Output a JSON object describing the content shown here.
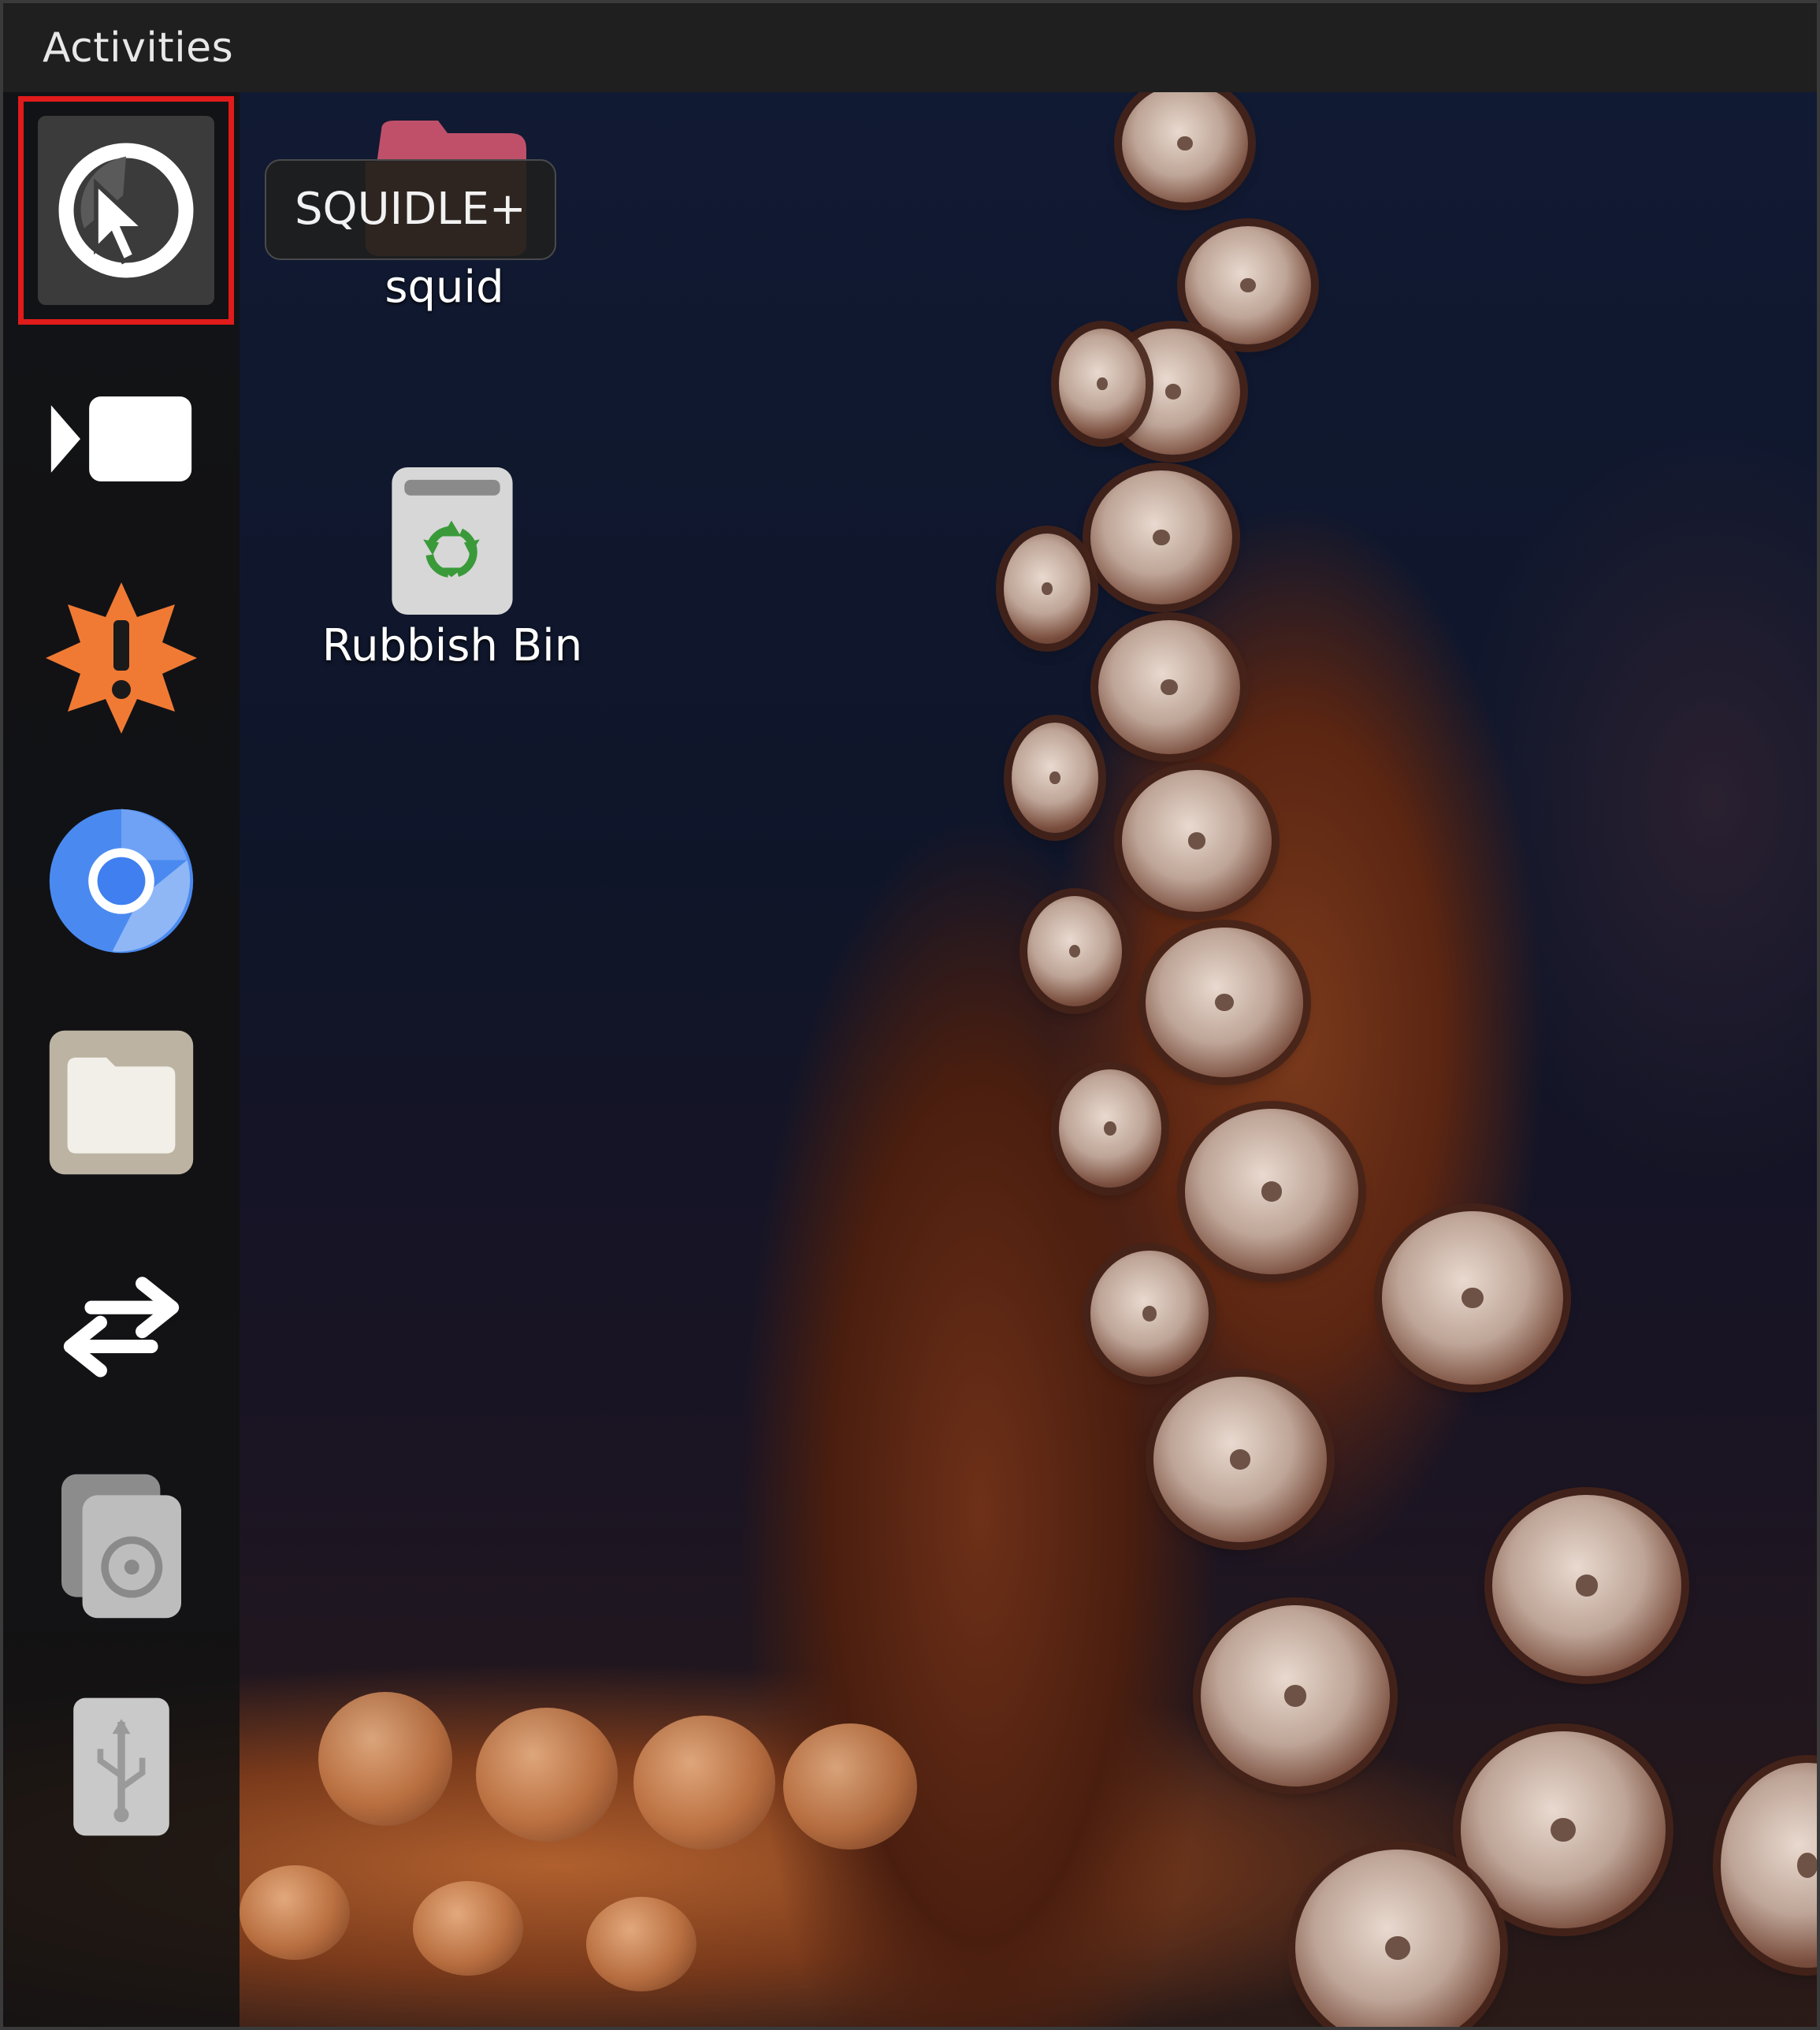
{
  "topbar": {
    "activities_label": "Activities"
  },
  "dock": {
    "items": [
      {
        "name": "SQUIDLE+",
        "icon": "squidle-cursor-globe-icon",
        "selected": true
      },
      {
        "name": "Video recorder",
        "icon": "video-camera-icon"
      },
      {
        "name": "Software updater",
        "icon": "alert-burst-icon"
      },
      {
        "name": "Chromium",
        "icon": "chromium-icon"
      },
      {
        "name": "Files",
        "icon": "folder-icon"
      },
      {
        "name": "Transfer",
        "icon": "swap-arrows-icon"
      },
      {
        "name": "Disk",
        "icon": "optical-drive-icon"
      },
      {
        "name": "USB drive",
        "icon": "usb-drive-icon"
      }
    ]
  },
  "tooltip": {
    "text": "SQUIDLE+"
  },
  "desktop": {
    "icons": [
      {
        "label": "squid",
        "icon": "folder-icon"
      },
      {
        "label": "Rubbish Bin",
        "icon": "trash-icon"
      }
    ]
  },
  "colors": {
    "selection_border": "#e01b1b",
    "dock_bg": "#121212",
    "topbar_bg": "#1f1f1f",
    "update_orange": "#f07a34",
    "chrome_blue": "#4a8af0"
  }
}
